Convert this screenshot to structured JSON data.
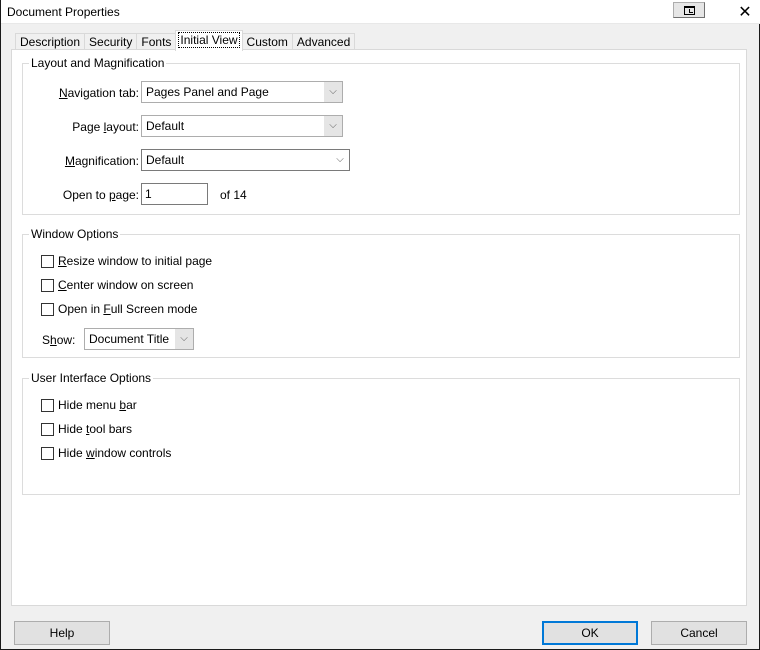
{
  "window": {
    "title": "Document Properties",
    "restore_icon": "restore-window-icon",
    "close_icon": "close-icon",
    "close_glyph": "✕"
  },
  "tabs": [
    {
      "label": "Description",
      "active": false
    },
    {
      "label": "Security",
      "active": false
    },
    {
      "label": "Fonts",
      "active": false
    },
    {
      "label": "Initial View",
      "active": true
    },
    {
      "label": "Custom",
      "active": false
    },
    {
      "label": "Advanced",
      "active": false
    }
  ],
  "layout_group": {
    "title": "Layout and Magnification",
    "navigation_tab": {
      "label_pre": "",
      "label_u": "N",
      "label_post": "avigation tab:",
      "value": "Pages Panel and Page"
    },
    "page_layout": {
      "label_pre": "Page ",
      "label_u": "l",
      "label_post": "ayout:",
      "value": "Default"
    },
    "magnification": {
      "label_pre": "",
      "label_u": "M",
      "label_post": "agnification:",
      "value": "Default"
    },
    "open_to_page": {
      "label_pre": "Open to ",
      "label_u": "p",
      "label_post": "age:",
      "value": "1",
      "of_text": "of 14"
    }
  },
  "window_group": {
    "title": "Window Options",
    "options": [
      {
        "pre": "",
        "u": "R",
        "post": "esize window to initial page",
        "checked": false
      },
      {
        "pre": "",
        "u": "C",
        "post": "enter window on screen",
        "checked": false
      },
      {
        "pre": "Open in ",
        "u": "F",
        "post": "ull Screen mode",
        "checked": false
      }
    ],
    "show": {
      "label_pre": "S",
      "label_u": "h",
      "label_post": "ow:",
      "value": "Document Title"
    }
  },
  "ui_group": {
    "title": "User Interface Options",
    "options": [
      {
        "pre": "Hide menu ",
        "u": "b",
        "post": "ar",
        "checked": false
      },
      {
        "pre": "Hide ",
        "u": "t",
        "post": "ool bars",
        "checked": false
      },
      {
        "pre": "Hide ",
        "u": "w",
        "post": "indow controls",
        "checked": false
      }
    ]
  },
  "buttons": {
    "help": "Help",
    "ok": "OK",
    "cancel": "Cancel"
  },
  "dropdown_glyph": "⌵",
  "colors": {
    "accent": "#0078d7",
    "dialog_bg": "#f0f0f0",
    "panel_bg": "#ffffff"
  }
}
